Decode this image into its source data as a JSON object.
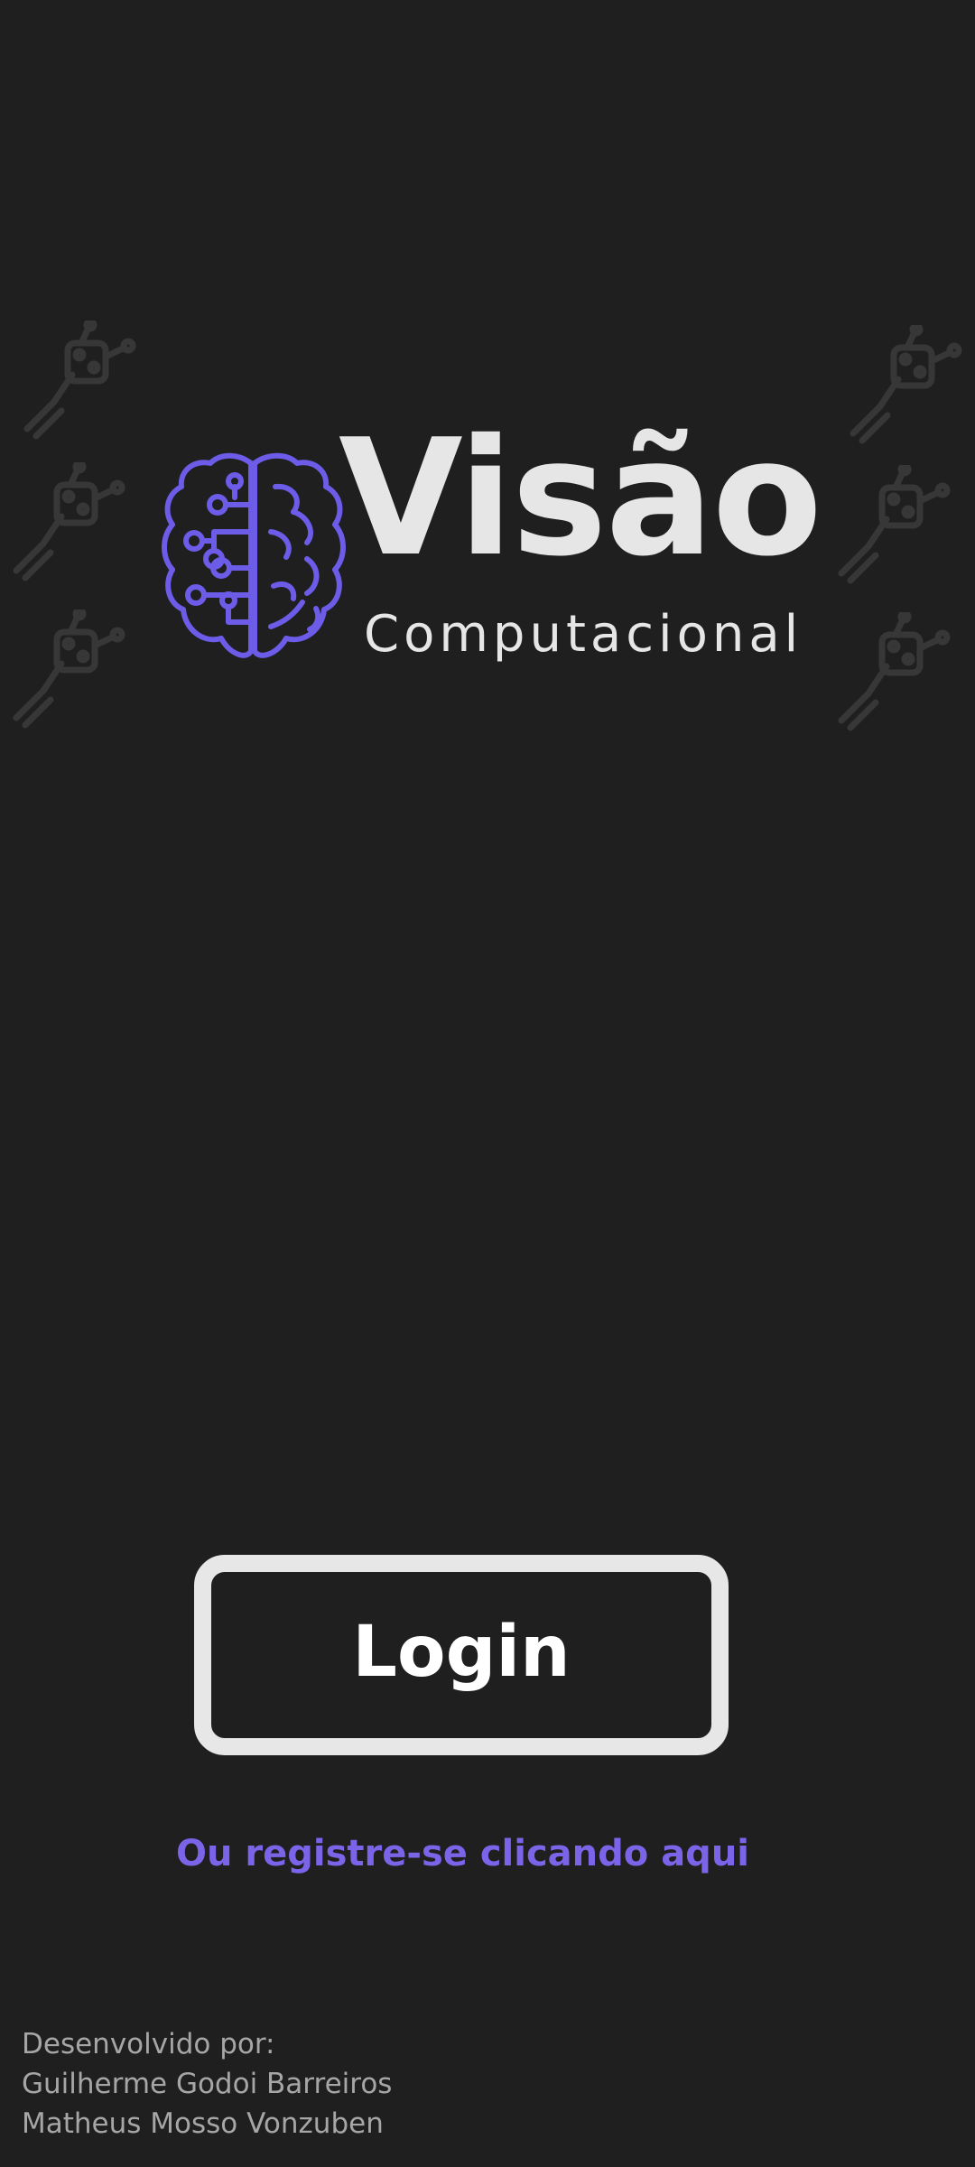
{
  "logo": {
    "title": "Visão",
    "subtitle": "Computacional",
    "icon": "brain-circuit-icon",
    "accent_color": "#6c5ce7"
  },
  "decorations": {
    "icon": "robot-arm-icon"
  },
  "login_button": {
    "label": "Login"
  },
  "register_link": {
    "label": "Ou registre-se clicando aqui",
    "color": "#7b64e8"
  },
  "credits": {
    "heading": "Desenvolvido por:",
    "authors": [
      "Guilherme Godoi Barreiros",
      "Matheus Mosso Vonzuben"
    ]
  },
  "colors": {
    "background": "#1f1f1f",
    "text_light": "#e6e6e6",
    "credits_text": "#a6a6a6"
  }
}
